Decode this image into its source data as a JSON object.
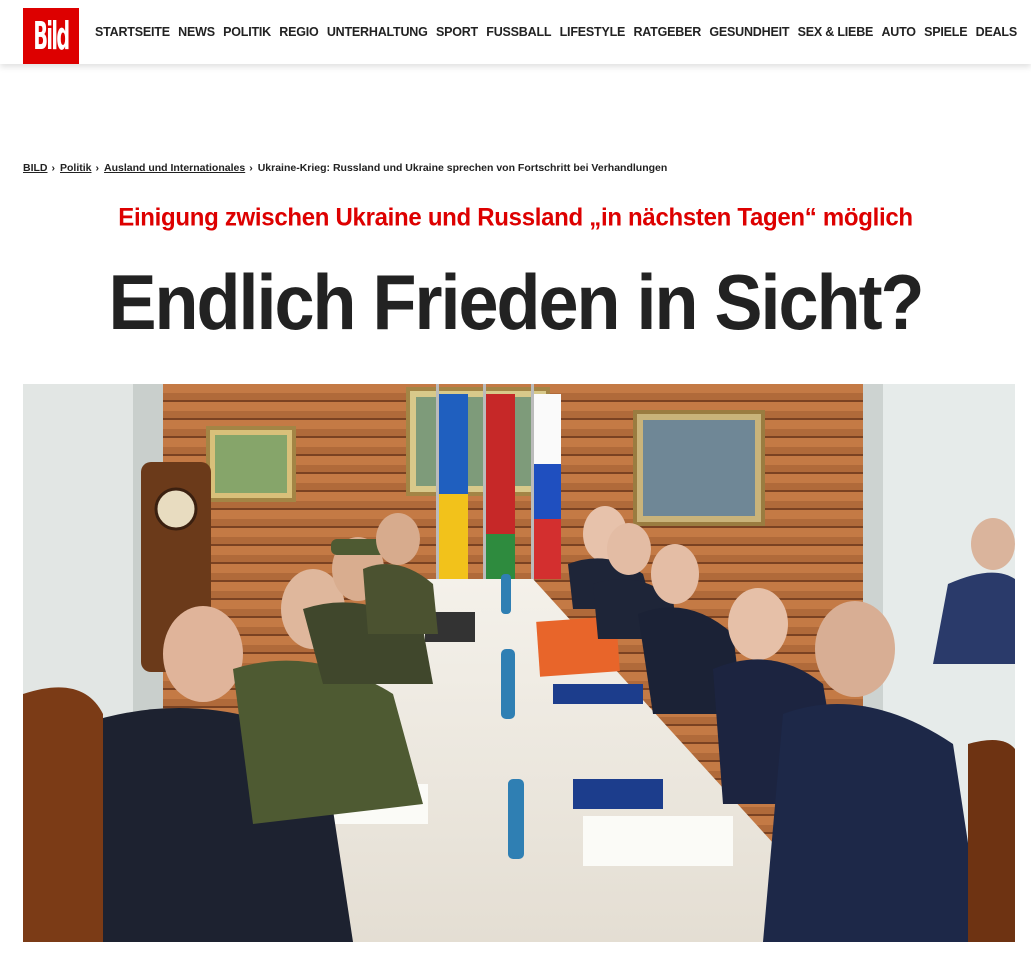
{
  "header": {
    "logo_text": "Bild",
    "nav": [
      "STARTSEITE",
      "NEWS",
      "POLITIK",
      "REGIO",
      "UNTERHALTUNG",
      "SPORT",
      "FUSSBALL",
      "LIFESTYLE",
      "RATGEBER",
      "GESUNDHEIT",
      "SEX & LIEBE",
      "AUTO",
      "SPIELE",
      "DEALS"
    ]
  },
  "breadcrumb": {
    "links": [
      "BILD",
      "Politik",
      "Ausland und Internationales"
    ],
    "separator": "›",
    "current": "Ukraine-Krieg: Russland und Ukraine sprechen von Fortschritt bei Verhandlungen"
  },
  "article": {
    "kicker": "Einigung zwischen Ukraine und Russland „in nächsten Tagen“ möglich",
    "headline": "Endlich Frieden in Sicht?"
  },
  "colors": {
    "brand_red": "#dd0000",
    "headline_dark": "#222222"
  }
}
